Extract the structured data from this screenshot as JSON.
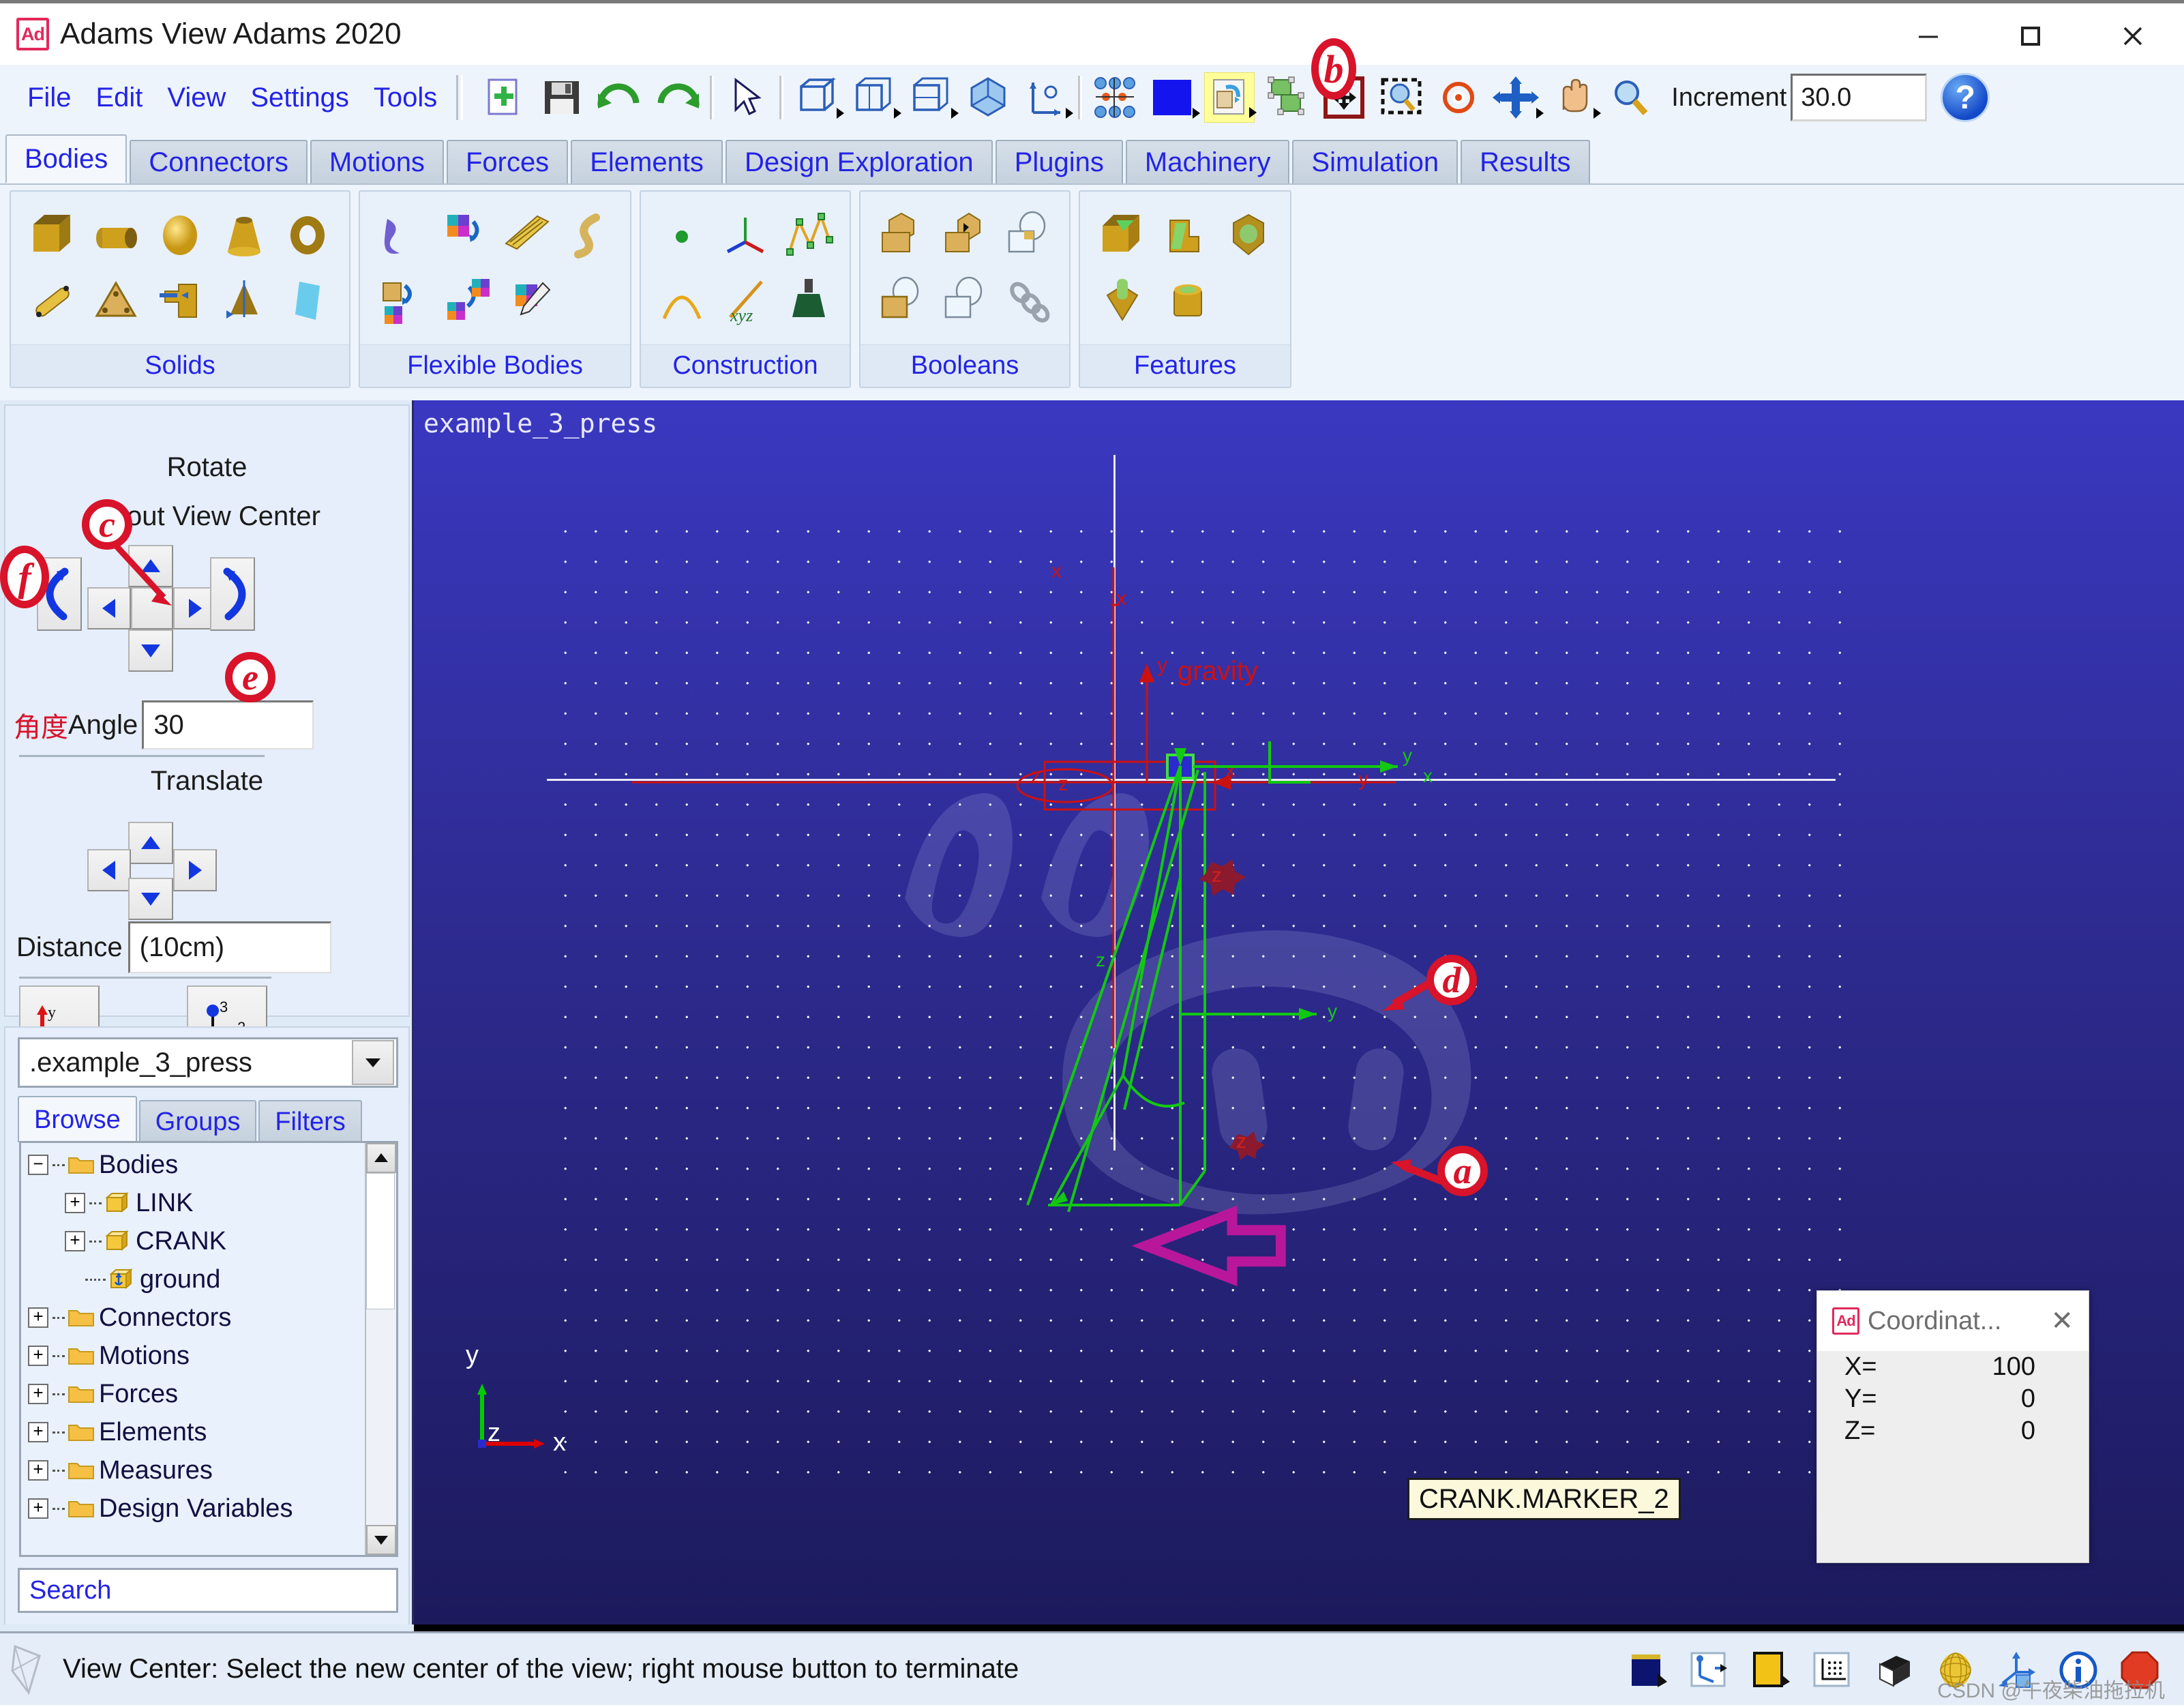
{
  "window": {
    "title": "Adams View Adams 2020",
    "logo_text": "Ad",
    "minimize": "minimize-icon",
    "maximize": "maximize-icon",
    "close": "close-icon"
  },
  "menu": {
    "items": [
      "File",
      "Edit",
      "View",
      "Settings",
      "Tools"
    ]
  },
  "toolbar": {
    "increment_label": "Increment",
    "increment_value": "30.0",
    "help_label": "?",
    "buttons": [
      "new-model-icon",
      "save-icon",
      "undo-icon",
      "redo-icon",
      "select-arrow-icon",
      "box-view-icon",
      "front-view-icon",
      "side-view-icon",
      "iso-view-icon",
      "axis-view-icon",
      "render-points-icon",
      "background-color-icon",
      "render-toggle-icon",
      "render-shaded-icon",
      "fit-view-icon",
      "zoom-box-icon",
      "view-center-icon",
      "rotate-view-icon",
      "pan-icon",
      "zoom-icon"
    ]
  },
  "ribbon": {
    "tabs": [
      "Bodies",
      "Connectors",
      "Motions",
      "Forces",
      "Elements",
      "Design Exploration",
      "Plugins",
      "Machinery",
      "Simulation",
      "Results"
    ],
    "active_tab": "Bodies",
    "groups": [
      {
        "label": "Solids",
        "row1": [
          "box-icon",
          "cylinder-icon",
          "sphere-icon",
          "frustum-icon",
          "torus-icon"
        ],
        "row2": [
          "link-icon",
          "plate-icon",
          "extrusion-icon",
          "revolution-icon",
          "plane-icon"
        ]
      },
      {
        "label": "Flexible Bodies",
        "row1": [
          "flex-body-icon",
          "rigid-to-flex-icon",
          "beam-icon",
          "spline-beam-icon"
        ],
        "row2": [
          "solid-to-flex-icon",
          "flex-to-flex-icon",
          "flex-edit-icon"
        ]
      },
      {
        "label": "Construction",
        "row1": [
          "point-icon",
          "marker-icon",
          "polyline-icon"
        ],
        "row2": [
          "arc-icon",
          "spline-xyz-icon",
          "csg-icon"
        ]
      },
      {
        "label": "Booleans",
        "row1": [
          "unite-icon",
          "merge-icon",
          "cut-icon"
        ],
        "row2": [
          "intersect-icon",
          "split-icon",
          "chain-icon"
        ]
      },
      {
        "label": "Features",
        "row1": [
          "fillet-icon",
          "chamfer-icon",
          "hollow-icon"
        ],
        "row2": [
          "extrude-feature-icon",
          "boss-icon"
        ]
      }
    ]
  },
  "left_panel": {
    "rotate": {
      "title": "Rotate",
      "subtitle": "About View Center",
      "angle_label_cn": "角度",
      "angle_label": "Angle",
      "angle_value": "30",
      "buttons": [
        "rotate-ccw-icon",
        "rotate-up-icon",
        "rotate-left-icon",
        "rotate-center-icon",
        "rotate-right-icon",
        "rotate-down-icon",
        "rotate-cw-icon"
      ]
    },
    "translate": {
      "title": "Translate",
      "distance_label": "Distance",
      "distance_value": "(10cm)",
      "buttons": [
        "translate-up-icon",
        "translate-left-icon",
        "translate-down-icon",
        "translate-right-icon"
      ]
    },
    "bottom_buttons": [
      "axis-origin-icon",
      "three-point-icon"
    ]
  },
  "browser": {
    "model_name": ".example_3_press",
    "tabs": [
      "Browse",
      "Groups",
      "Filters"
    ],
    "active_tab": "Browse",
    "search_placeholder": "Search",
    "tree": [
      {
        "label": "Bodies",
        "indent": 0,
        "expander": "minus",
        "icon": "folder-open-icon"
      },
      {
        "label": "LINK",
        "indent": 1,
        "expander": "plus",
        "icon": "body-cube-icon"
      },
      {
        "label": "CRANK",
        "indent": 1,
        "expander": "plus",
        "icon": "body-cube-icon"
      },
      {
        "label": "ground",
        "indent": 1,
        "expander": "none",
        "icon": "ground-anchor-icon"
      },
      {
        "label": "Connectors",
        "indent": 0,
        "expander": "plus",
        "icon": "folder-icon"
      },
      {
        "label": "Motions",
        "indent": 0,
        "expander": "plus",
        "icon": "folder-icon"
      },
      {
        "label": "Forces",
        "indent": 0,
        "expander": "plus",
        "icon": "folder-icon"
      },
      {
        "label": "Elements",
        "indent": 0,
        "expander": "plus",
        "icon": "folder-icon"
      },
      {
        "label": "Measures",
        "indent": 0,
        "expander": "plus",
        "icon": "folder-icon"
      },
      {
        "label": "Design Variables",
        "indent": 0,
        "expander": "plus",
        "icon": "folder-icon"
      }
    ]
  },
  "viewport": {
    "model_label": "example_3_press",
    "tooltip": "CRANK.MARKER_2",
    "gravity_label": "gravity",
    "triad": {
      "x": "x",
      "y": "y",
      "z": "z"
    },
    "marker_axis_labels": {
      "x": "x",
      "y": "y",
      "z": "z"
    }
  },
  "annotations": [
    {
      "id": "b",
      "label": "b"
    },
    {
      "id": "c",
      "label": "c"
    },
    {
      "id": "f",
      "label": "f"
    },
    {
      "id": "e",
      "label": "e"
    },
    {
      "id": "d",
      "label": "d"
    },
    {
      "id": "a",
      "label": "a"
    }
  ],
  "coordinate_window": {
    "title": "Coordinat...",
    "logo_text": "Ad",
    "close": "close-icon",
    "rows": [
      {
        "key": "X=",
        "value": "100"
      },
      {
        "key": "Y=",
        "value": "0"
      },
      {
        "key": "Z=",
        "value": "0"
      }
    ]
  },
  "statusbar": {
    "message": "View Center: Select the new center of the view; right mouse button to terminate",
    "watermark": "CSDN @午夜柴油拖拉机",
    "icons": [
      "view-background-icon",
      "triad-display-icon",
      "render-color-icon",
      "grid-icon",
      "shaded-box-icon",
      "sphere-render-icon",
      "axis-move-icon",
      "info-icon",
      "stop-icon"
    ]
  },
  "colors": {
    "menu_text": "#2323e6",
    "ribbon_bg": "#eef4fb",
    "viewport_top": "#3a38c0",
    "viewport_bottom": "#1c1a5c",
    "annotation_red": "#d8132a",
    "tooltip_bg": "#fbf8dc",
    "highlight_yellow": "#ffff9a"
  }
}
